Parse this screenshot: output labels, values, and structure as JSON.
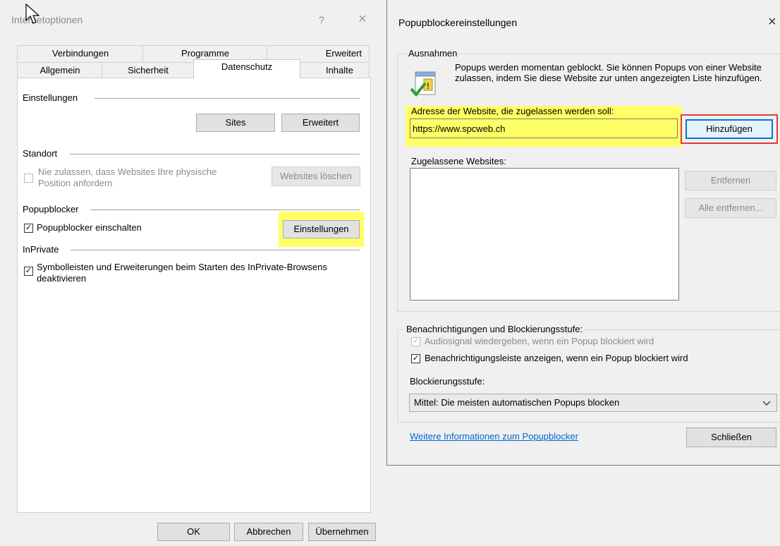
{
  "left_dialog": {
    "title": "Internetoptionen",
    "help_glyph": "?",
    "close_glyph": "×",
    "tabs_row1": [
      "Verbindungen",
      "Programme",
      "Erweitert"
    ],
    "tabs_row2": [
      "Allgemein",
      "Sicherheit",
      "Datenschutz",
      "Inhalte"
    ],
    "active_tab": "Datenschutz",
    "settings": {
      "label": "Einstellungen",
      "sites_button": "Sites",
      "advanced_button": "Erweitert"
    },
    "location": {
      "label": "Standort",
      "checkbox_label": "Nie zulassen, dass Websites Ihre physische Position anfordern",
      "checkbox_checked": false,
      "clear_button": "Websites löschen"
    },
    "popup_blocker": {
      "label": "Popupblocker",
      "checkbox_label": "Popupblocker einschalten",
      "checkbox_checked": true,
      "settings_button": "Einstellungen"
    },
    "inprivate": {
      "label": "InPrivate",
      "checkbox_label": "Symbolleisten und Erweiterungen beim Starten des InPrivate-Browsens deaktivieren",
      "checkbox_checked": true
    },
    "footer": {
      "ok_button": "OK",
      "cancel_button": "Abbrechen",
      "apply_button": "Übernehmen"
    }
  },
  "right_dialog": {
    "title": "Popupblockereinstellungen",
    "close_glyph": "×",
    "exceptions": {
      "group_label": "Ausnahmen",
      "info_text": "Popups werden momentan geblockt. Sie können Popups von einer Website zulassen, indem Sie diese Website zur unten angezeigten Liste hinzufügen.",
      "address_label": "Adresse der Website, die zugelassen werden soll:",
      "address_value": "https://www.spcweb.ch",
      "add_button": "Hinzufügen",
      "allowed_label": "Zugelassene Websites:",
      "allowed_sites": [],
      "remove_button": "Entfernen",
      "remove_all_button": "Alle entfernen..."
    },
    "notifications": {
      "group_label": "Benachrichtigungen und Blockierungsstufe:",
      "sound_label": "Audiosignal wiedergeben, wenn ein Popup blockiert wird",
      "sound_checked": true,
      "bar_label": "Benachrichtigungsleiste anzeigen, wenn ein Popup blockiert wird",
      "bar_checked": true,
      "level_label": "Blockierungsstufe:",
      "level_value": "Mittel: Die meisten automatischen Popups blocken"
    },
    "more_info_link": "Weitere Informationen zum Popupblocker",
    "close_button": "Schließen"
  },
  "colors": {
    "highlight": "#ffff66",
    "red_outline": "#e53935",
    "focus_blue": "#0078d7",
    "link": "#0066cc"
  }
}
